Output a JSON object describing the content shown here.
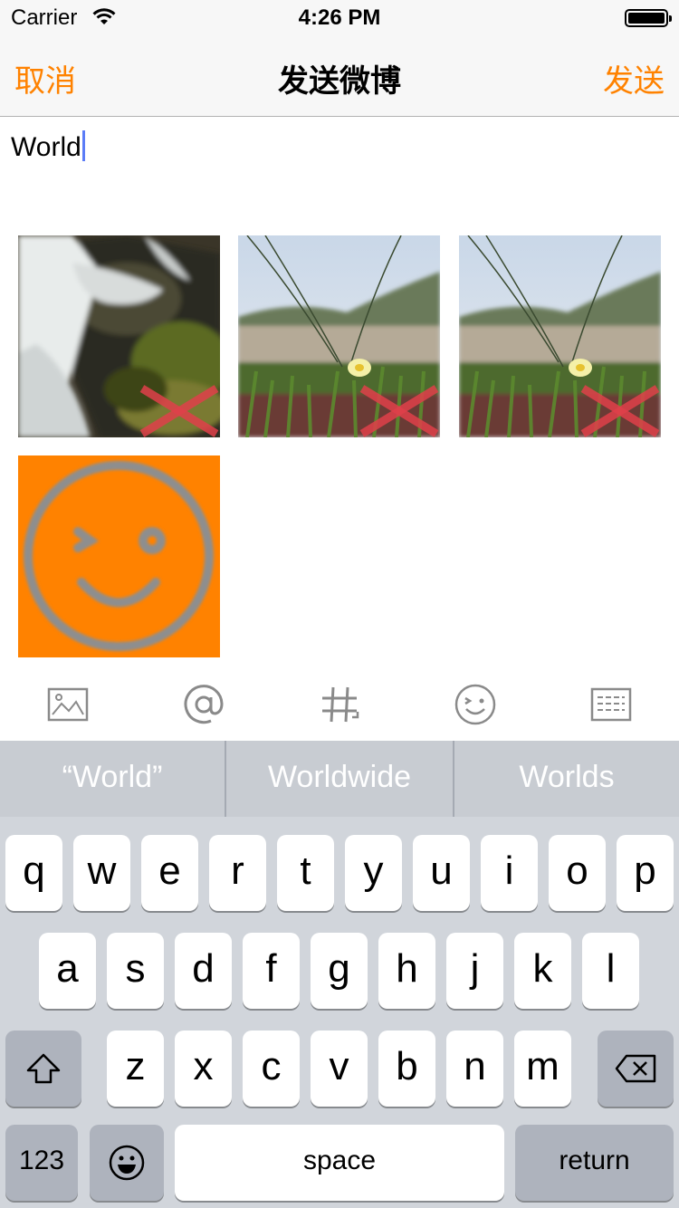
{
  "status_bar": {
    "carrier": "Carrier",
    "time": "4:26 PM"
  },
  "nav": {
    "cancel_label": "取消",
    "title": "发送微博",
    "send_label": "发送"
  },
  "compose": {
    "text": "World"
  },
  "toolbar": {
    "items": [
      {
        "icon": "picture-icon"
      },
      {
        "icon": "mention-icon"
      },
      {
        "icon": "hashtag-icon"
      },
      {
        "icon": "emoticon-icon"
      },
      {
        "icon": "keyboard-icon"
      }
    ]
  },
  "suggestions": [
    "“World”",
    "Worldwide",
    "Worlds"
  ],
  "keyboard": {
    "row1": [
      "q",
      "w",
      "e",
      "r",
      "t",
      "y",
      "u",
      "i",
      "o",
      "p"
    ],
    "row2": [
      "a",
      "s",
      "d",
      "f",
      "g",
      "h",
      "j",
      "k",
      "l"
    ],
    "row3": [
      "z",
      "x",
      "c",
      "v",
      "b",
      "n",
      "m"
    ],
    "numbers_label": "123",
    "space_label": "space",
    "return_label": "return"
  },
  "colors": {
    "accent": "#ff8200",
    "emoji_bg": "#ff8200",
    "delete_mark": "#e0404a"
  }
}
